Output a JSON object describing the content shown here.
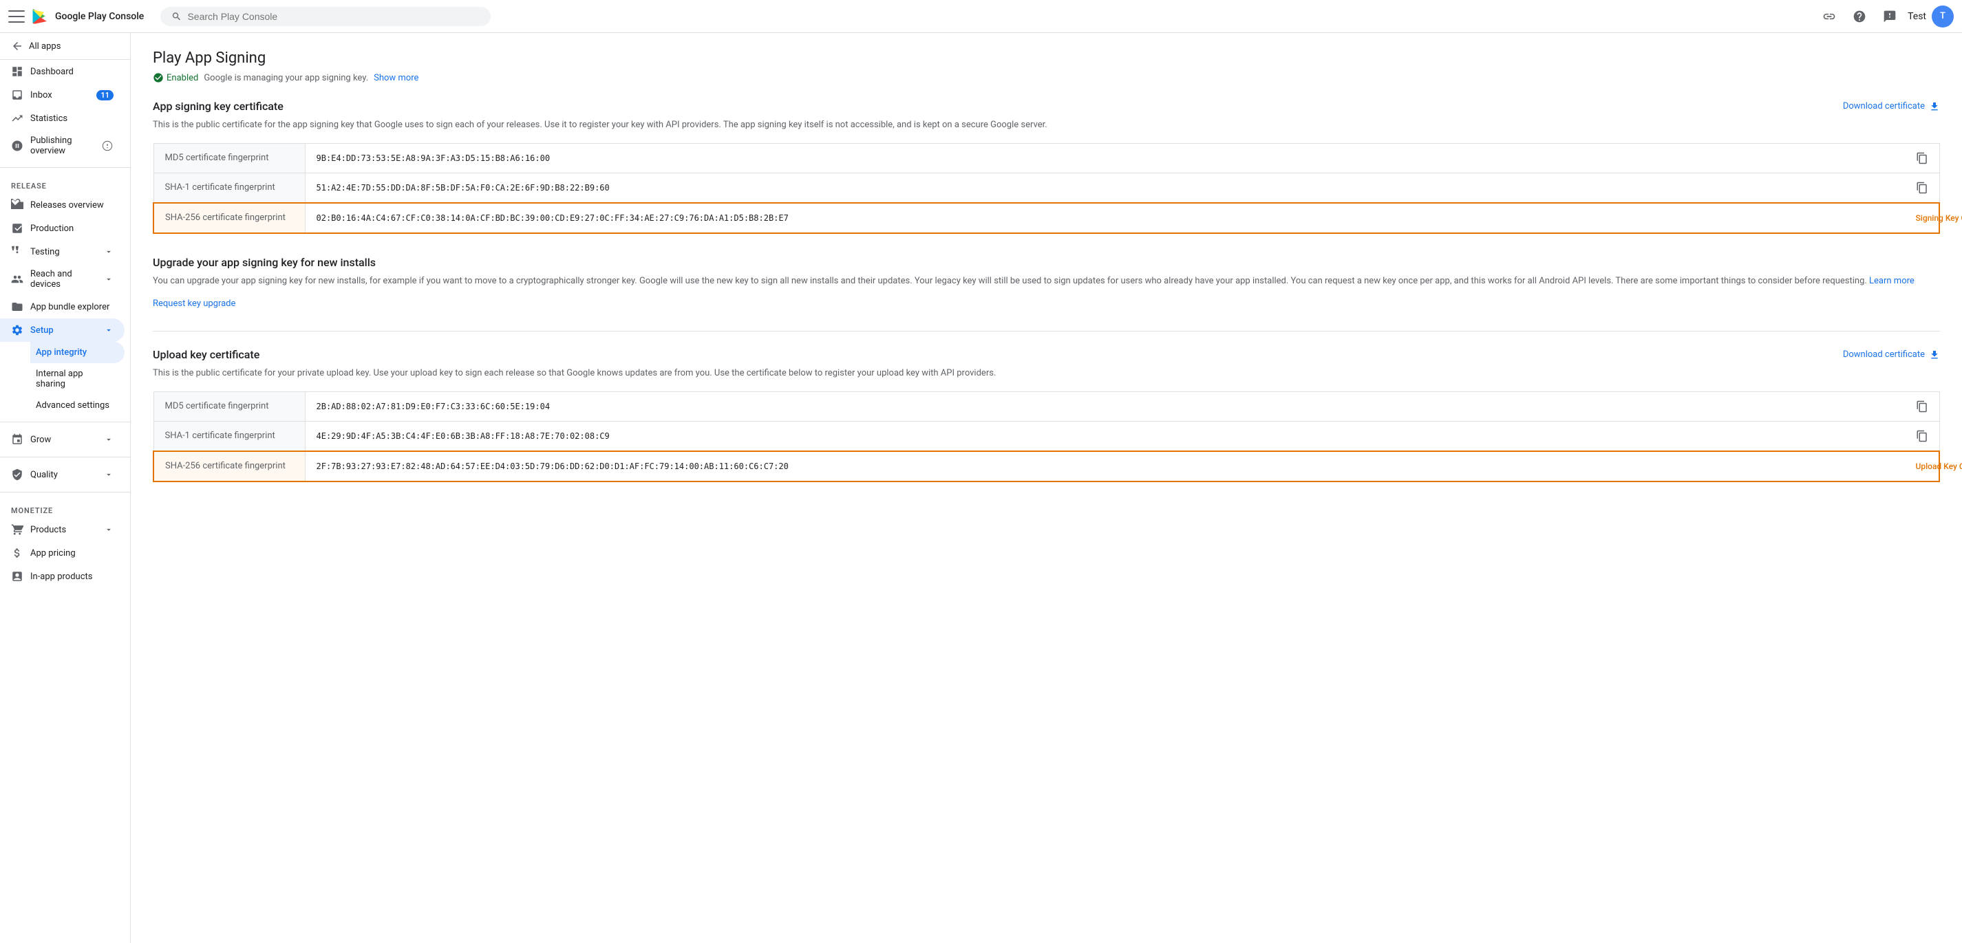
{
  "topbar": {
    "menu_label": "Menu",
    "logo_text": "Google Play Console",
    "search_placeholder": "Search Play Console",
    "help_label": "Help",
    "feedback_label": "Send feedback",
    "user_label": "Test"
  },
  "sidebar": {
    "all_apps_label": "All apps",
    "items": [
      {
        "id": "dashboard",
        "label": "Dashboard",
        "icon": "dashboard"
      },
      {
        "id": "inbox",
        "label": "Inbox",
        "badge": "11",
        "icon": "inbox"
      },
      {
        "id": "statistics",
        "label": "Statistics",
        "icon": "statistics"
      },
      {
        "id": "publishing-overview",
        "label": "Publishing overview",
        "icon": "publishing"
      }
    ],
    "release_section": "Release",
    "release_items": [
      {
        "id": "releases-overview",
        "label": "Releases overview",
        "icon": "releases"
      },
      {
        "id": "production",
        "label": "Production",
        "icon": "production"
      },
      {
        "id": "testing",
        "label": "Testing",
        "icon": "testing",
        "expandable": true
      },
      {
        "id": "reach-devices",
        "label": "Reach and devices",
        "icon": "reach",
        "expandable": true
      },
      {
        "id": "app-bundle",
        "label": "App bundle explorer",
        "icon": "bundle"
      },
      {
        "id": "setup",
        "label": "Setup",
        "icon": "setup",
        "active": true,
        "expandable": true
      }
    ],
    "setup_sub_items": [
      {
        "id": "app-integrity",
        "label": "App integrity",
        "active": true
      },
      {
        "id": "internal-sharing",
        "label": "Internal app sharing"
      },
      {
        "id": "advanced-settings",
        "label": "Advanced settings"
      }
    ],
    "grow_section": "Grow",
    "quality_section": "Quality",
    "monetize_section": "Monetize",
    "monetize_items": [
      {
        "id": "products",
        "label": "Products",
        "expandable": true
      },
      {
        "id": "app-pricing",
        "label": "App pricing"
      },
      {
        "id": "in-app-products",
        "label": "In-app products"
      }
    ]
  },
  "main": {
    "page_title": "Play App Signing",
    "status_enabled": "Enabled",
    "status_desc": "Google is managing your app signing key.",
    "show_more": "Show more",
    "app_signing_cert": {
      "title": "App signing key certificate",
      "desc": "This is the public certificate for the app signing key that Google uses to sign each of your releases. Use it to register your key with API providers. The app signing key itself is not accessible, and is kept on a secure Google server.",
      "download_label": "Download certificate",
      "rows": [
        {
          "id": "md5",
          "label": "MD5 certificate fingerprint",
          "value": "9B:E4:DD:73:53:5E:A8:9A:3F:A3:D5:15:B8:A6:16:00",
          "highlighted": false
        },
        {
          "id": "sha1",
          "label": "SHA-1 certificate fingerprint",
          "value": "51:A2:4E:7D:55:DD:DA:8F:5B:DF:5A:F0:CA:2E:6F:9D:B8:22:B9:60",
          "highlighted": false
        },
        {
          "id": "sha256",
          "label": "SHA-256 certificate fingerprint",
          "value": "02:B0:16:4A:C4:67:CF:C0:38:14:0A:CF:BD:BC:39:00:CD:E9:27:0C:FF:34:AE:27:C9:76:DA:A1:D5:B8:2B:E7",
          "highlighted": true,
          "highlighted_label": "Signing Key Certiicate"
        }
      ]
    },
    "upgrade_section": {
      "title": "Upgrade your app signing key for new installs",
      "desc": "You can upgrade your app signing key for new installs, for example if you want to move to a cryptographically stronger key. Google will use the new key to sign all new installs and their updates. Your legacy key will still be used to sign updates for users who already have your app installed. You can request a new key once per app, and this works for all Android API levels. There are some important things to consider before requesting.",
      "learn_more": "Learn more",
      "request_btn": "Request key upgrade"
    },
    "upload_key_cert": {
      "title": "Upload key certificate",
      "desc": "This is the public certificate for your private upload key. Use your upload key to sign each release so that Google knows updates are from you. Use the certificate below to register your upload key with API providers.",
      "download_label": "Download certificate",
      "rows": [
        {
          "id": "md5",
          "label": "MD5 certificate fingerprint",
          "value": "2B:AD:88:02:A7:81:D9:E0:F7:C3:33:6C:60:5E:19:04",
          "highlighted": false
        },
        {
          "id": "sha1",
          "label": "SHA-1 certificate fingerprint",
          "value": "4E:29:9D:4F:A5:3B:C4:4F:E0:6B:3B:A8:FF:18:A8:7E:70:02:08:C9",
          "highlighted": false
        },
        {
          "id": "sha256",
          "label": "SHA-256 certificate fingerprint",
          "value": "2F:7B:93:27:93:E7:82:48:AD:64:57:EE:D4:03:5D:79:D6:DD:62:D0:D1:AF:FC:79:14:00:AB:11:60:C6:C7:20",
          "highlighted": true,
          "highlighted_label": "Upload Key Certificate"
        }
      ]
    }
  }
}
